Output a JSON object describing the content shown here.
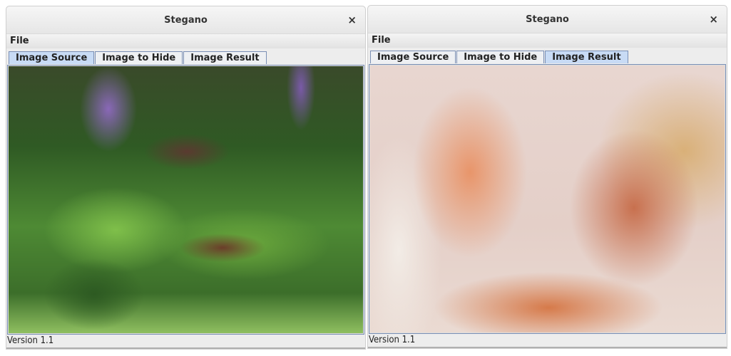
{
  "windows": [
    {
      "title": "Stegano",
      "menu": [
        "File"
      ],
      "tabs": [
        "Image Source",
        "Image to Hide",
        "Image Result"
      ],
      "active_tab": "Image Source",
      "status": "Version 1.1"
    },
    {
      "title": "Stegano",
      "menu": [
        "File"
      ],
      "tabs": [
        "Image Source",
        "Image to Hide",
        "Image Result"
      ],
      "active_tab": "Image Result",
      "status": "Version 1.1"
    }
  ],
  "close_glyph": "×"
}
